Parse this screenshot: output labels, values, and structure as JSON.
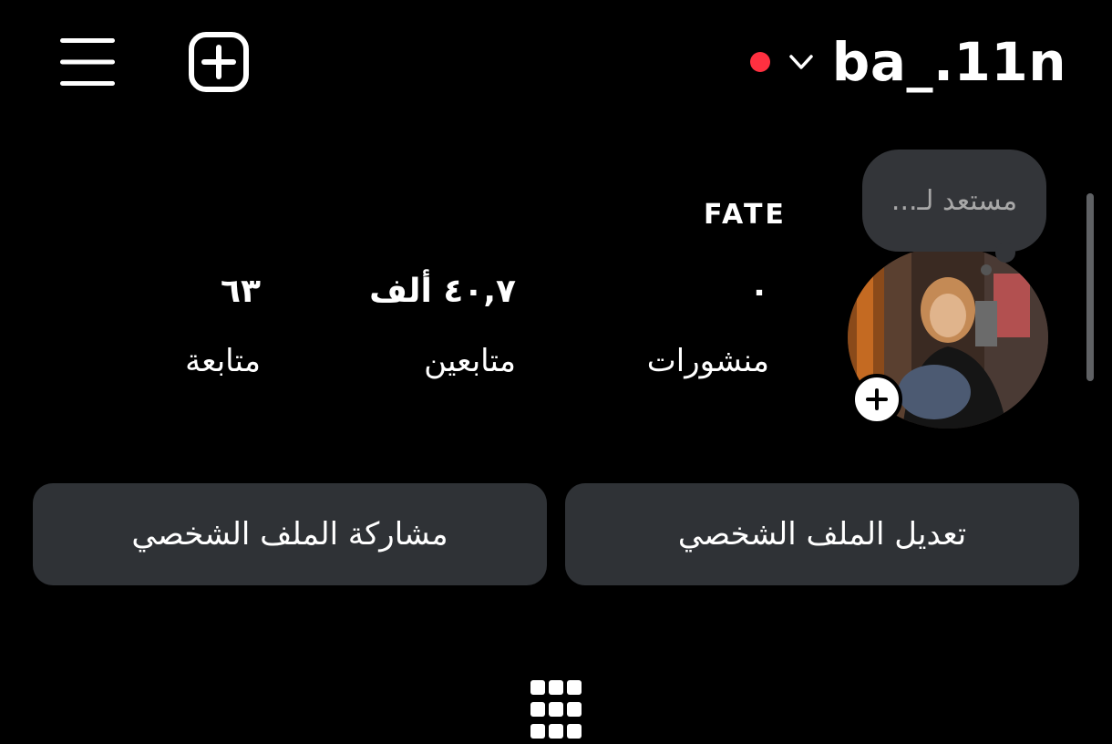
{
  "header": {
    "username": "ba_.11n",
    "icons": {
      "menu": "menu-icon",
      "create": "plus-square-icon",
      "account_switch": "chevron-down-icon",
      "live_indicator": "red-dot"
    },
    "live_color": "#ff3040"
  },
  "profile": {
    "note": "مستعد لـ...",
    "badge_text": "FATE",
    "stats": {
      "posts": {
        "value": "٠",
        "label": "منشورات"
      },
      "followers": {
        "value": "٤٠,٧ ألف",
        "label": "متابعين"
      },
      "following": {
        "value": "٦٣",
        "label": "متابعة"
      }
    }
  },
  "actions": {
    "edit_profile": "تعديل الملف الشخصي",
    "share_profile": "مشاركة الملف الشخصي"
  },
  "tabs": {
    "grid": "grid-icon"
  },
  "colors": {
    "background": "#000000",
    "button_bg": "#2f3236",
    "note_bg": "#333539"
  }
}
